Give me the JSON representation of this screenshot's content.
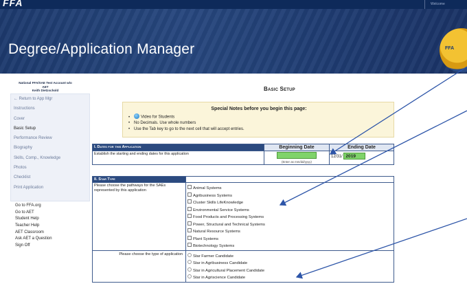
{
  "header": {
    "logo_fragment": "FFA",
    "account_label": "Welcome"
  },
  "banner": {
    "title": "Degree/Application Manager",
    "emblem_text": "FFA"
  },
  "sidebar": {
    "account_line1": "National FFA/SAE Test Account w/o",
    "account_line2": "AET",
    "account_line3": "Keith Dietzschold",
    "menu": [
      "← Return to App Mgr",
      "Instructions",
      "Cover",
      "Basic Setup",
      "Performance Review",
      "Biography",
      "Skills, Comp., Knowledge",
      "Photos",
      "Checklist",
      "Print Application"
    ],
    "links": [
      "Go to FFA.org",
      "Go to AET",
      "Student Help",
      "Teacher Help",
      "AET Classroom",
      "Ask AET a Question",
      "Sign Off"
    ]
  },
  "main": {
    "title": "Basic Setup",
    "notes": {
      "title": "Special Notes before you begin this page:",
      "items": [
        "Video for Students",
        "No Decimals. Use whole numbers",
        "Use the Tab key to go to the next cell that will accept entries."
      ]
    },
    "dates": {
      "header": "I. Dates for this Application",
      "beginning_label": "Beginning Date",
      "ending_label": "Ending Date",
      "description": "Establish the starting and ending dates for this application",
      "beginning_value": "",
      "ending_prefix": "12/31/",
      "ending_year": "2019",
      "hint": "(Enter as mm/dd/yyyy)"
    },
    "star": {
      "header": "II. Star Type",
      "pathways_question": "Please choose the pathways for the SAEs represented by this application",
      "pathways": [
        "Animal Systems",
        "Agribusiness Systems",
        "Cluster Skills LifeKnowledge",
        "Environmental Service Systems",
        "Food Products and Processing Systems",
        "Power, Structural and Technical Systems",
        "Natural Resource Systems",
        "Plant Systems",
        "Biotechnology Systems"
      ],
      "type_question": "Please choose the type of application",
      "types": [
        "Star Farmer Candidate",
        "Star in Agribusiness Candidate",
        "Star in Agricultural Placement Candidate",
        "Star in Agriscience Candidate"
      ]
    }
  }
}
